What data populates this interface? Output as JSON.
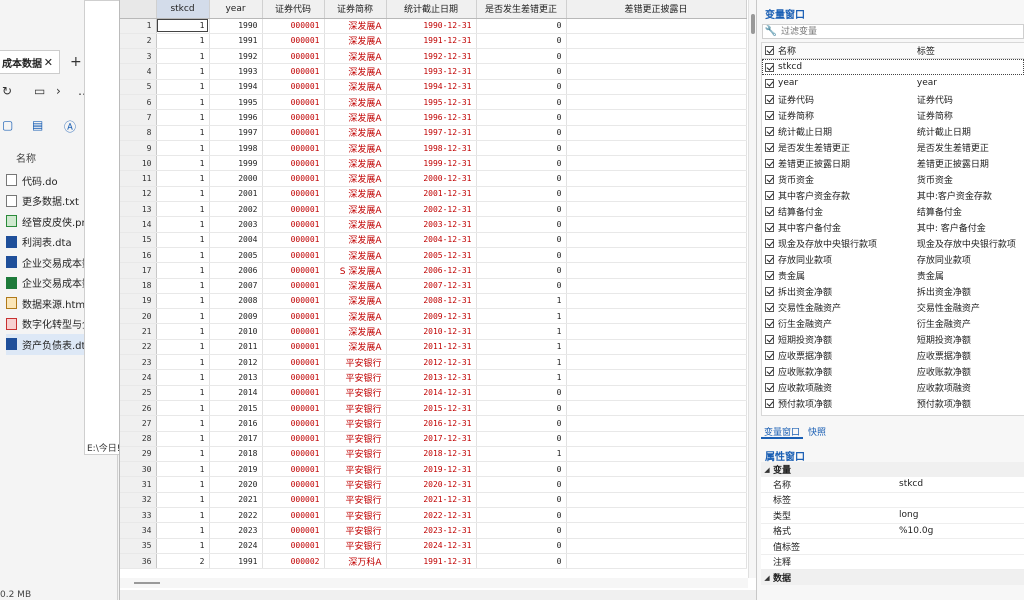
{
  "explorer": {
    "tab_title": "成本数据",
    "tab_close": "✕",
    "new_tab": "+",
    "col_name": "名称",
    "files": [
      {
        "name": "代码.do",
        "type": "do"
      },
      {
        "name": "更多数据.txt",
        "type": "txt"
      },
      {
        "name": "经管皮皮侠.png",
        "type": "png"
      },
      {
        "name": "利润表.dta",
        "type": "dta"
      },
      {
        "name": "企业交易成本数",
        "type": "dta"
      },
      {
        "name": "企业交易成本数",
        "type": "xls"
      },
      {
        "name": "数据来源.html",
        "type": "html"
      },
      {
        "name": "数字化转型与企",
        "type": "pdf"
      },
      {
        "name": "资产负债表.dta",
        "type": "dta",
        "selected": true
      }
    ],
    "status": "0.2 MB"
  },
  "stata": {
    "path": "E:\\今日!"
  },
  "grid": {
    "columns": [
      "stkcd",
      "year",
      "证券代码",
      "证券简称",
      "统计截止日期",
      "是否发生差错更正",
      "差错更正披露日"
    ],
    "rows": [
      [
        "1",
        "1",
        "1990",
        "000001",
        "深发展A",
        "1990-12-31",
        "0"
      ],
      [
        "2",
        "1",
        "1991",
        "000001",
        "深发展A",
        "1991-12-31",
        "0"
      ],
      [
        "3",
        "1",
        "1992",
        "000001",
        "深发展A",
        "1992-12-31",
        "0"
      ],
      [
        "4",
        "1",
        "1993",
        "000001",
        "深发展A",
        "1993-12-31",
        "0"
      ],
      [
        "5",
        "1",
        "1994",
        "000001",
        "深发展A",
        "1994-12-31",
        "0"
      ],
      [
        "6",
        "1",
        "1995",
        "000001",
        "深发展A",
        "1995-12-31",
        "0"
      ],
      [
        "7",
        "1",
        "1996",
        "000001",
        "深发展A",
        "1996-12-31",
        "0"
      ],
      [
        "8",
        "1",
        "1997",
        "000001",
        "深发展A",
        "1997-12-31",
        "0"
      ],
      [
        "9",
        "1",
        "1998",
        "000001",
        "深发展A",
        "1998-12-31",
        "0"
      ],
      [
        "10",
        "1",
        "1999",
        "000001",
        "深发展A",
        "1999-12-31",
        "0"
      ],
      [
        "11",
        "1",
        "2000",
        "000001",
        "深发展A",
        "2000-12-31",
        "0"
      ],
      [
        "12",
        "1",
        "2001",
        "000001",
        "深发展A",
        "2001-12-31",
        "0"
      ],
      [
        "13",
        "1",
        "2002",
        "000001",
        "深发展A",
        "2002-12-31",
        "0"
      ],
      [
        "14",
        "1",
        "2003",
        "000001",
        "深发展A",
        "2003-12-31",
        "0"
      ],
      [
        "15",
        "1",
        "2004",
        "000001",
        "深发展A",
        "2004-12-31",
        "0"
      ],
      [
        "16",
        "1",
        "2005",
        "000001",
        "深发展A",
        "2005-12-31",
        "0"
      ],
      [
        "17",
        "1",
        "2006",
        "000001",
        "S 深发展A",
        "2006-12-31",
        "0"
      ],
      [
        "18",
        "1",
        "2007",
        "000001",
        "深发展A",
        "2007-12-31",
        "0"
      ],
      [
        "19",
        "1",
        "2008",
        "000001",
        "深发展A",
        "2008-12-31",
        "1"
      ],
      [
        "20",
        "1",
        "2009",
        "000001",
        "深发展A",
        "2009-12-31",
        "1"
      ],
      [
        "21",
        "1",
        "2010",
        "000001",
        "深发展A",
        "2010-12-31",
        "1"
      ],
      [
        "22",
        "1",
        "2011",
        "000001",
        "深发展A",
        "2011-12-31",
        "1"
      ],
      [
        "23",
        "1",
        "2012",
        "000001",
        "平安银行",
        "2012-12-31",
        "1"
      ],
      [
        "24",
        "1",
        "2013",
        "000001",
        "平安银行",
        "2013-12-31",
        "1"
      ],
      [
        "25",
        "1",
        "2014",
        "000001",
        "平安银行",
        "2014-12-31",
        "0"
      ],
      [
        "26",
        "1",
        "2015",
        "000001",
        "平安银行",
        "2015-12-31",
        "0"
      ],
      [
        "27",
        "1",
        "2016",
        "000001",
        "平安银行",
        "2016-12-31",
        "0"
      ],
      [
        "28",
        "1",
        "2017",
        "000001",
        "平安银行",
        "2017-12-31",
        "0"
      ],
      [
        "29",
        "1",
        "2018",
        "000001",
        "平安银行",
        "2018-12-31",
        "1"
      ],
      [
        "30",
        "1",
        "2019",
        "000001",
        "平安银行",
        "2019-12-31",
        "0"
      ],
      [
        "31",
        "1",
        "2020",
        "000001",
        "平安银行",
        "2020-12-31",
        "0"
      ],
      [
        "32",
        "1",
        "2021",
        "000001",
        "平安银行",
        "2021-12-31",
        "0"
      ],
      [
        "33",
        "1",
        "2022",
        "000001",
        "平安银行",
        "2022-12-31",
        "0"
      ],
      [
        "34",
        "1",
        "2023",
        "000001",
        "平安银行",
        "2023-12-31",
        "0"
      ],
      [
        "35",
        "1",
        "2024",
        "000001",
        "平安银行",
        "2024-12-31",
        "0"
      ],
      [
        "36",
        "2",
        "1991",
        "000002",
        "深万科A",
        "1991-12-31",
        "0"
      ]
    ]
  },
  "variables": {
    "title": "变量窗口",
    "filter_placeholder": "过滤变量",
    "header_name": "名称",
    "header_label": "标签",
    "items": [
      {
        "name": "stkcd",
        "label": ""
      },
      {
        "name": "year",
        "label": "year"
      },
      {
        "name": "证券代码",
        "label": "证券代码"
      },
      {
        "name": "证券简称",
        "label": "证券简称"
      },
      {
        "name": "统计截止日期",
        "label": "统计截止日期"
      },
      {
        "name": "是否发生差错更正",
        "label": "是否发生差错更正"
      },
      {
        "name": "差错更正披露日期",
        "label": "差错更正披露日期"
      },
      {
        "name": "货币资金",
        "label": "货币资金"
      },
      {
        "name": "其中客户资金存款",
        "label": "其中:客户资金存款"
      },
      {
        "name": "结算备付金",
        "label": "结算备付金"
      },
      {
        "name": "其中客户备付金",
        "label": "其中: 客户备付金"
      },
      {
        "name": "现金及存放中央银行款项",
        "label": "现金及存放中央银行款项"
      },
      {
        "name": "存放同业款项",
        "label": "存放同业款项"
      },
      {
        "name": "贵金属",
        "label": "贵金属"
      },
      {
        "name": "拆出资金净额",
        "label": "拆出资金净额"
      },
      {
        "name": "交易性金融资产",
        "label": "交易性金融资产"
      },
      {
        "name": "衍生金融资产",
        "label": "衍生金融资产"
      },
      {
        "name": "短期投资净额",
        "label": "短期投资净额"
      },
      {
        "name": "应收票据净额",
        "label": "应收票据净额"
      },
      {
        "name": "应收账款净额",
        "label": "应收账款净额"
      },
      {
        "name": "应收款项融资",
        "label": "应收款项融资"
      },
      {
        "name": "预付款项净额",
        "label": "预付款项净额"
      }
    ]
  },
  "tabs": [
    "变量窗口",
    "快照"
  ],
  "properties": {
    "title": "属性窗口",
    "group_var": "变量",
    "group_data": "数据",
    "rows": [
      {
        "k": "名称",
        "v": "stkcd"
      },
      {
        "k": "标签",
        "v": ""
      },
      {
        "k": "类型",
        "v": "long"
      },
      {
        "k": "格式",
        "v": "%10.0g"
      },
      {
        "k": "值标签",
        "v": ""
      },
      {
        "k": "注释",
        "v": ""
      }
    ]
  }
}
